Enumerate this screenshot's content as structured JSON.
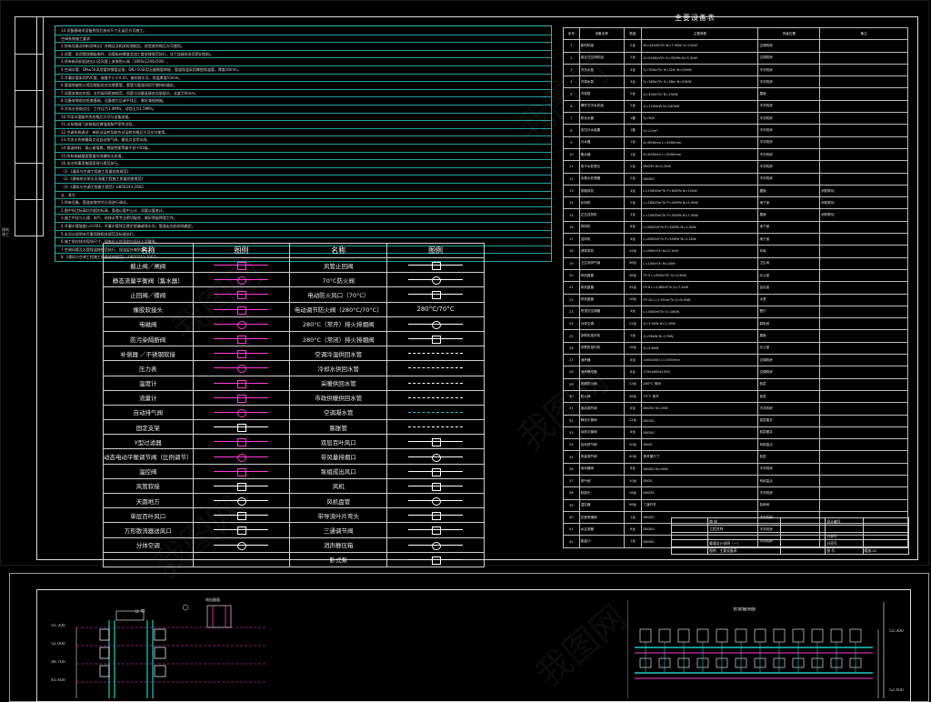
{
  "notes": {
    "lines": [
      "14.设备基础须设备到货后核对尺寸无误后方可施工。",
      "  空调系统施工要求：",
      "  1.所有设备及材料须有出厂合格证及相关检测报告，经验收合格后方可使用。",
      "  2.风管：采用镀锌钢板制作，风管板材厚度及加工要求按规范执行，法兰连接处采用密封垫料。",
      "  3.所有新风机组进出口及风管上安装防火阀（1800x1200x500）。",
      "  4.空调水管：DN≤50采用镀锌钢管丝接，DN>50采用无缝钢管焊接，管道保温采用橡塑保温管，厚度30mm。",
      "  5.冷凝水管采用PVC管，坡度不小于0.01，坡向排水点，保温厚度10mm。",
      "  6.管道穿越防火墙及楼板处应设钢套管，套管与管道间用不燃材料填实。",
      "  7.风管安装应牢固，支吊架间距按规范，风管与设备连接处设软接头，长度150mm。",
      "  8.设备安装前应检查基础，设备就位后调平找正，做好减振措施。",
      "  9.冷冻水系统试压：工作压力1.0MPa，试验压力1.5MPa。",
      " 10.冷冻水管路冲洗合格后方可与设备连接。",
      " 11.水系统阀门安装前应做强度和严密性试验。",
      " 12.空调系统调试：单机试运转及联合试运转合格后方可交付使用。",
      " 13.冷冻水系统最高点设自动排气阀，最低点设泄水阀。",
      " 14.保温材料：离心玻璃棉，燃烧性能等级不低于B1级。",
      " 15.所有穿越屋面管道均须做防水处理。",
      " 16.未注明事项按国家现行规范执行。",
      "  （1）《通风与空调工程施工质量验收规范》",
      "  （2）《建筑给水排水及采暖工程施工质量验收规范》",
      "  （3）《通风与空调工程施工规范》GB50243-2002",
      "  五、其它",
      "  1.所有设备、管道安装完毕后须进行调试。",
      "  2.图中所注标高均为相对标高，管道以管中心计，风管以管底计。",
      "  3.施工中应与土建、电气、给排水等专业密切配合，做好预留预埋工作。",
      "  4.冷凝水管坡度i=0.003，冷凝水管排至就近地漏或排水沟，管道走向由现场确定。",
      "  5.本设计说明未尽事项按相关规范及标准执行。",
      "  6.施工前应核对现场尺寸，如有出入应及时与设计人员联系。",
      "  7.空调风管及水管保温按规范执行，保温层外做防潮层。",
      "  8.《通风与空调工程施工质量验收规范》（GB50243-2002）"
    ]
  },
  "legend": {
    "headers": [
      "名称",
      "图例",
      "名称",
      "图例"
    ],
    "left": [
      "截止阀／闸阀",
      "静态流量平衡阀（集水器）",
      "止回阀／蝶阀",
      "橡胶软接头",
      "电磁阀",
      "防污染隔断阀",
      "补偿器 ／不锈钢软接",
      "压力表",
      "温度计",
      "流量计",
      "自动排气阀",
      "固定支架",
      "Y型过滤器",
      "动态电动平衡调节阀（比例调节）",
      "温控阀",
      "风管软接",
      "天圆地方",
      "单层百叶风口",
      "方形散流器送风口",
      "分体空调"
    ],
    "right": [
      "风管止回阀",
      "70°C防火阀",
      "电动防火风口（70°C）",
      "电动调节防火阀（280°C/70°C）",
      "280°C（常开）排火排烟阀",
      "280°C（常闭）排火排烟阀",
      "空调冷温供回水管",
      "冷却水供回水管",
      "采暖供回水管",
      "市政供暖供回水管",
      "空调凝水管",
      "膨胀管",
      "双层百叶风口",
      "带风量排烟口",
      "泵组成出风口",
      "风机",
      "风机盘管",
      "带导流叶片弯头",
      "三通调节阀",
      "消声静压箱",
      "卧式泵"
    ],
    "inline_labels": {
      "fire_temp": "280°C/70°C"
    }
  },
  "equipment": {
    "title": "主要设备表",
    "headers": [
      "序号",
      "设备名称",
      "数量",
      "主要参数",
      "安装位置",
      "备注"
    ],
    "rows": [
      [
        "1",
        "新风机组",
        "2台",
        "W=2400m³/h  N=7.5kW  Q=12kW",
        "空调机房",
        ""
      ],
      [
        "2",
        "组合式空调机组",
        "2台",
        "G=5000m³/h  H=350Pa  N=5.5kW",
        "空调机房",
        ""
      ],
      [
        "3",
        "冷冻水泵",
        "3台",
        "Q=300m³/h  H=32m  N=45kW",
        "冷冻机房",
        ""
      ],
      [
        "4",
        "冷却水泵",
        "3台",
        "Q=360m³/h  H=28m  N=55kW",
        "冷冻机房",
        ""
      ],
      [
        "5",
        "冷却塔",
        "2台",
        "Q=400m³/h  N=15kW",
        "屋面",
        ""
      ],
      [
        "6",
        "螺杆式冷水机组",
        "2台",
        "Q=1200kW  N=240kW",
        "冷冻机房",
        ""
      ],
      [
        "7",
        "软化水器",
        "1套",
        "Q=5t/h",
        "冷冻机房",
        ""
      ],
      [
        "8",
        "定压补水装置",
        "1套",
        "V=1.0m³",
        "冷冻机房",
        ""
      ],
      [
        "9",
        "分水器",
        "1台",
        "D=800mm  L=3000mm",
        "冷冻机房",
        ""
      ],
      [
        "10",
        "集水器",
        "1台",
        "D=800mm  L=3000mm",
        "冷冻机房",
        ""
      ],
      [
        "11",
        "电子水处理仪",
        "2台",
        "DN250  N=0.2kW",
        "冷冻机房",
        ""
      ],
      [
        "12",
        "全程水处理器",
        "2台",
        "DN300",
        "冷冻机房",
        ""
      ],
      [
        "13",
        "排烟风机",
        "4台",
        "L=25000m³/h  P=650Pa  N=11kW",
        "屋面",
        "消防联动"
      ],
      [
        "14",
        "补风机",
        "2台",
        "L=18000m³/h  P=450Pa  N=5.5kW",
        "地下室",
        "消防联动"
      ],
      [
        "15",
        "正压送风机",
        "3台",
        "L=20000m³/h  P=500Pa  N=7.5kW",
        "屋面",
        "消防联动"
      ],
      [
        "16",
        "排风机",
        "6台",
        "L=6000m³/h  P=300Pa  N=1.5kW",
        "地下室",
        ""
      ],
      [
        "17",
        "送风机",
        "4台",
        "L=8000m³/h  P=350Pa  N=2.2kW",
        "地下室",
        ""
      ],
      [
        "18",
        "诱导风机",
        "24台",
        "L=800m³/h  N=0.1kW",
        "车库",
        ""
      ],
      [
        "19",
        "卫生间排气扇",
        "36台",
        "L=150m³/h  N=30W",
        "卫生间",
        ""
      ],
      [
        "20",
        "风机盘管",
        "48台",
        "FP-5  L=850m³/h  Q=4.5kW",
        "办公室",
        ""
      ],
      [
        "21",
        "风机盘管",
        "32台",
        "FP-8  L=1360m³/h  Q=7.2kW",
        "会议室",
        ""
      ],
      [
        "22",
        "风机盘管",
        "16台",
        "FP-10  L=1700m³/h  Q=9.0kW",
        "大堂",
        ""
      ],
      [
        "23",
        "吊顶式空调器",
        "4台",
        "L=3000m³/h  Q=18kW",
        "餐厅",
        ""
      ],
      [
        "24",
        "分体空调",
        "12台",
        "Q=3.5kW  N=1.2kW",
        "弱电间",
        ""
      ],
      [
        "25",
        "多联机室外机",
        "2台",
        "Q=56kW  N=17kW",
        "屋面",
        ""
      ],
      [
        "26",
        "多联机室内机",
        "18台",
        "Q=5.6kW",
        "办公室",
        ""
      ],
      [
        "27",
        "消声器",
        "8台",
        "1000x500  L=1000mm",
        "空调机房",
        ""
      ],
      [
        "28",
        "消声静压箱",
        "8台",
        "1250x800x1000",
        "空调机房",
        ""
      ],
      [
        "29",
        "排烟防火阀",
        "12台",
        "280°C  常闭",
        "各层",
        ""
      ],
      [
        "30",
        "防火阀",
        "36台",
        "70°C  常开",
        "各层",
        ""
      ],
      [
        "31",
        "电动调节阀",
        "6台",
        "DN250  N=20W",
        "冷冻机房",
        ""
      ],
      [
        "32",
        "静态平衡阀",
        "12台",
        "DN150",
        "各层管井",
        ""
      ],
      [
        "33",
        "动态平衡阀",
        "8台",
        "DN100",
        "各层管井",
        ""
      ],
      [
        "34",
        "自动排气阀",
        "20台",
        "DN20",
        "系统高点",
        ""
      ],
      [
        "35",
        "风量调节阀",
        "40台",
        "按风管尺寸",
        "各层",
        ""
      ],
      [
        "36",
        "电动蝶阀",
        "6台",
        "DN300  N=40W",
        "冷冻机房",
        ""
      ],
      [
        "37",
        "排气阀",
        "10台",
        "DN25",
        "系统高点",
        ""
      ],
      [
        "38",
        "软接头",
        "16台",
        "DN250",
        "冷冻机房",
        ""
      ],
      [
        "39",
        "温控器",
        "96台",
        "三速开关",
        "各房间",
        ""
      ],
      [
        "40",
        "压差旁通阀",
        "1台",
        "DN200",
        "冷冻机房",
        ""
      ],
      [
        "41",
        "水过滤器",
        "6台",
        "DN300",
        "冷冻机房",
        ""
      ],
      [
        "42",
        "能量计",
        "1台",
        "DN300",
        "冷冻机房",
        ""
      ]
    ]
  },
  "title_block": {
    "rows": [
      [
        "",
        "审 核",
        "",
        "设计编号",
        ""
      ],
      [
        "",
        "工程名称",
        "",
        "",
        ""
      ],
      [
        "",
        "",
        "",
        "分部号",
        ""
      ],
      [
        "",
        "暖通设计说明（一）",
        "",
        "分项号",
        ""
      ],
      [
        "",
        "图例、主要设备表",
        "",
        "图 号",
        "暖施-02"
      ]
    ]
  },
  "lower_left": {
    "elev": [
      "55.300",
      "52.000",
      "48.700",
      "45.400"
    ],
    "title": "立 管",
    "tag_top": "排出屋面"
  },
  "lower_right": {
    "title": "管道轴测图",
    "elev": [
      "55.300",
      "52.400"
    ]
  },
  "side_text": [
    "建",
    "筑",
    "施",
    "工"
  ],
  "watermark": "我图网"
}
